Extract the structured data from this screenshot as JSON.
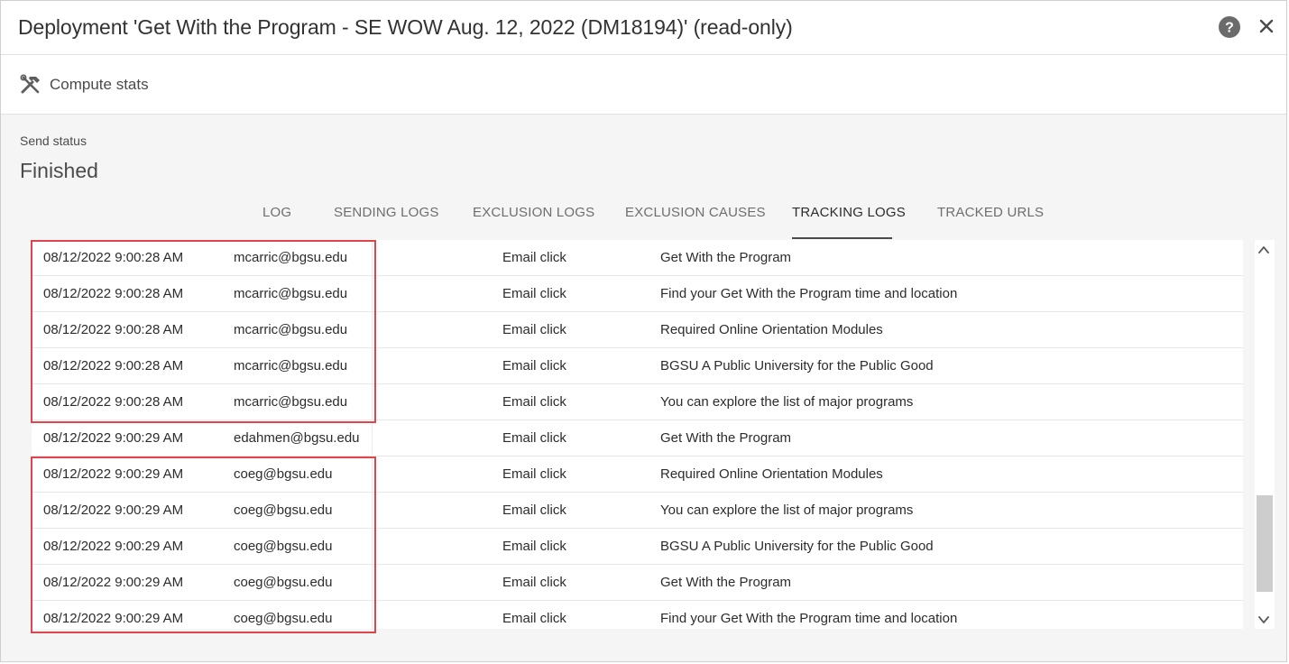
{
  "dialog": {
    "title": "Deployment 'Get With the Program - SE WOW Aug. 12, 2022 (DM18194)' (read-only)",
    "help_icon": "question-circle-icon",
    "close_icon": "close-icon"
  },
  "toolbar": {
    "compute_label": "Compute stats",
    "compute_icon": "hammer-wrench-icon"
  },
  "status": {
    "label": "Send status",
    "value": "Finished"
  },
  "tabs": [
    {
      "label": "LOG",
      "active": false
    },
    {
      "label": "SENDING LOGS",
      "active": false
    },
    {
      "label": "EXCLUSION LOGS",
      "active": false
    },
    {
      "label": "EXCLUSION CAUSES",
      "active": false
    },
    {
      "label": "TRACKING LOGS",
      "active": true
    },
    {
      "label": "TRACKED URLS",
      "active": false
    }
  ],
  "rows": [
    {
      "date": "08/12/2022 9:00:28 AM",
      "email": "mcarric@bgsu.edu",
      "type": "Email click",
      "label": "Get With the Program"
    },
    {
      "date": "08/12/2022 9:00:28 AM",
      "email": "mcarric@bgsu.edu",
      "type": "Email click",
      "label": "Find your Get With the Program time and location"
    },
    {
      "date": "08/12/2022 9:00:28 AM",
      "email": "mcarric@bgsu.edu",
      "type": "Email click",
      "label": "Required Online Orientation Modules"
    },
    {
      "date": "08/12/2022 9:00:28 AM",
      "email": "mcarric@bgsu.edu",
      "type": "Email click",
      "label": "BGSU A Public University for the Public Good"
    },
    {
      "date": "08/12/2022 9:00:28 AM",
      "email": "mcarric@bgsu.edu",
      "type": "Email click",
      "label": "You can explore the list of major programs"
    },
    {
      "date": "08/12/2022 9:00:29 AM",
      "email": "edahmen@bgsu.edu",
      "type": "Email click",
      "label": "Get With the Program"
    },
    {
      "date": "08/12/2022 9:00:29 AM",
      "email": "coeg@bgsu.edu",
      "type": "Email click",
      "label": "Required Online Orientation Modules"
    },
    {
      "date": "08/12/2022 9:00:29 AM",
      "email": "coeg@bgsu.edu",
      "type": "Email click",
      "label": "You can explore the list of major programs"
    },
    {
      "date": "08/12/2022 9:00:29 AM",
      "email": "coeg@bgsu.edu",
      "type": "Email click",
      "label": "BGSU A Public University for the Public Good"
    },
    {
      "date": "08/12/2022 9:00:29 AM",
      "email": "coeg@bgsu.edu",
      "type": "Email click",
      "label": "Get With the Program"
    },
    {
      "date": "08/12/2022 9:00:29 AM",
      "email": "coeg@bgsu.edu",
      "type": "Email click",
      "label": "Find your Get With the Program time and location"
    }
  ],
  "annotations": {
    "color": "#e0454d"
  },
  "scrollbar": {
    "up_icon": "chevron-up-icon",
    "down_icon": "chevron-down-icon"
  }
}
